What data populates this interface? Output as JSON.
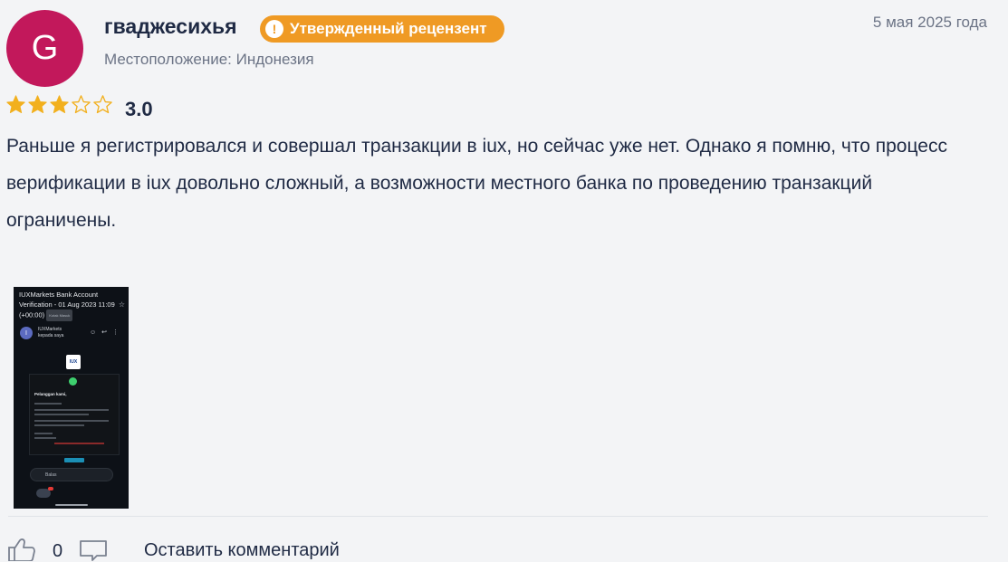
{
  "review": {
    "avatar_letter": "G",
    "username": "гваджесихья",
    "badge": {
      "icon": "!",
      "label": "Утвержденный рецензент",
      "color": "#ef9a24"
    },
    "location": "Местоположение: Индонезия",
    "date": "5 мая 2025 года",
    "rating": {
      "value": "3.0",
      "stars_filled": 3,
      "stars_total": 5
    },
    "text": "Раньше я регистрировался и совершал транзакции в iux, но сейчас уже нет. Однако я помню, что процесс верификации в iux довольно сложный, а возможности местного банка по проведению транзакций ограничены."
  },
  "attachment": {
    "title": "IUXMarkets Bank Account Verification - 01 Aug 2023 11:09 (+00:00)",
    "tag": "Kotak Masuk",
    "sender": "IUXMarkets",
    "sender_sub": "kepada saya",
    "logo": "IUX",
    "heading": "Pelanggan kami,",
    "reply_label": "Balas"
  },
  "footer": {
    "like_count": "0",
    "comment_label": "Оставить комментарий"
  },
  "colors": {
    "avatar": "#c2185b",
    "star_filled": "#f2b01e",
    "background": "#f3f4f6",
    "text": "#1f2a44"
  }
}
